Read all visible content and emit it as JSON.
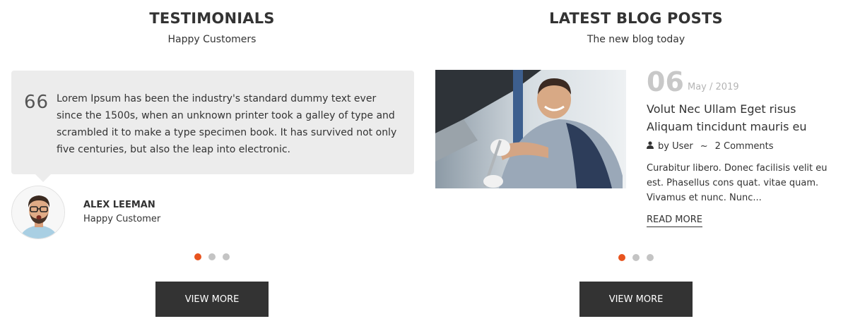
{
  "testimonials": {
    "title": "TESTIMONIALS",
    "subtitle": "Happy Customers",
    "quote_mark": "66",
    "quote": "Lorem Ipsum has been the industry's standard dummy text ever since the 1500s, when an unknown printer took a galley of type and scrambled it to make a type specimen book. It has survived not only five centuries, but also the leap into electronic.",
    "author_name": "ALEX LEEMAN",
    "author_role": "Happy Customer",
    "view_more_label": "VIEW MORE"
  },
  "blog": {
    "title": "LATEST BLOG POSTS",
    "subtitle": "The new blog today",
    "post": {
      "day": "06",
      "month_year": "May /  2019",
      "title": "Volut Nec Ullam Eget risus Aliquam tincidunt mauris eu",
      "author": "by User",
      "separator": "~",
      "comments": "2 Comments",
      "excerpt": "Curabitur libero. Donec facilisis velit eu est. Phasellus cons quat. vitae quam. Vivamus et nunc. Nunc...",
      "read_more_label": "READ MORE"
    },
    "view_more_label": "VIEW MORE"
  },
  "colors": {
    "accent": "#e8541f",
    "button_bg": "#333333",
    "quote_bg": "#ececec",
    "date_gray": "#c8c8c8"
  },
  "icons": {
    "quote": "quote-icon",
    "user": "user-icon"
  }
}
